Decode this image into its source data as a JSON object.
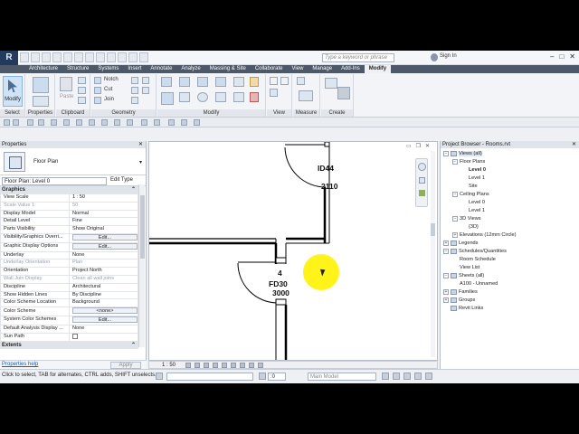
{
  "app": {
    "logo": "R",
    "search_placeholder": "Type a keyword or phrase",
    "sign_in": "Sign In"
  },
  "ribbon_tabs": [
    "Architecture",
    "Structure",
    "Systems",
    "Insert",
    "Annotate",
    "Analyze",
    "Massing & Site",
    "Collaborate",
    "View",
    "Manage",
    "Add-Ins",
    "Modify"
  ],
  "ribbon": {
    "modify_label": "Modify",
    "groups": [
      "Select",
      "Properties",
      "Clipboard",
      "Geometry",
      "Modify",
      "View",
      "Measure",
      "Create"
    ],
    "clipboard_paste": "Paste",
    "geometry_items": [
      "Notch",
      "Cut",
      "Join"
    ]
  },
  "properties": {
    "title": "Properties",
    "type_name": "Floor Plan",
    "instance": "Floor Plan: Level 0",
    "edit_type": "Edit Type",
    "section_graphics": "Graphics",
    "section_extents": "Extents",
    "rows": [
      {
        "k": "View Scale",
        "v": "1 : 50"
      },
      {
        "k": "Scale Value    1:",
        "v": "50"
      },
      {
        "k": "Display Model",
        "v": "Normal"
      },
      {
        "k": "Detail Level",
        "v": "Fine"
      },
      {
        "k": "Parts Visibility",
        "v": "Show Original"
      },
      {
        "k": "Visibility/Graphics Overri...",
        "v": "Edit..."
      },
      {
        "k": "Graphic Display Options",
        "v": "Edit..."
      },
      {
        "k": "Underlay",
        "v": "None"
      },
      {
        "k": "Underlay Orientation",
        "v": "Plan"
      },
      {
        "k": "Orientation",
        "v": "Project North"
      },
      {
        "k": "Wall Join Display",
        "v": "Clean all wall joins"
      },
      {
        "k": "Discipline",
        "v": "Architectural"
      },
      {
        "k": "Show Hidden Lines",
        "v": "By Discipline"
      },
      {
        "k": "Color Scheme Location",
        "v": "Background"
      },
      {
        "k": "Color Scheme",
        "v": "<none>"
      },
      {
        "k": "System Color Schemes",
        "v": "Edit..."
      },
      {
        "k": "Default Analysis Display ...",
        "v": "None"
      },
      {
        "k": "Sun Path",
        "v": ""
      }
    ],
    "help": "Properties help",
    "apply": "Apply"
  },
  "view": {
    "scale": "1 : 50",
    "tags": {
      "id44": "ID44",
      "d2110": "2110",
      "n4": "4",
      "fd30": "FD30",
      "d3000": "3000"
    }
  },
  "browser": {
    "title": "Project Browser - Rooms.rvt",
    "tree": [
      {
        "label": "Views (all)",
        "depth": 0,
        "tw": "−",
        "sel": true
      },
      {
        "label": "Floor Plans",
        "depth": 1,
        "tw": "−"
      },
      {
        "label": "Level 0",
        "depth": 2,
        "bold": true
      },
      {
        "label": "Level 1",
        "depth": 2
      },
      {
        "label": "Site",
        "depth": 2
      },
      {
        "label": "Ceiling Plans",
        "depth": 1,
        "tw": "−"
      },
      {
        "label": "Level 0",
        "depth": 2
      },
      {
        "label": "Level 1",
        "depth": 2
      },
      {
        "label": "3D Views",
        "depth": 1,
        "tw": "−"
      },
      {
        "label": "{3D}",
        "depth": 2
      },
      {
        "label": "Elevations (12mm Circle)",
        "depth": 1,
        "tw": "+"
      },
      {
        "label": "Legends",
        "depth": 0,
        "tw": "+",
        "icon": true
      },
      {
        "label": "Schedules/Quantities",
        "depth": 0,
        "tw": "−",
        "icon": true
      },
      {
        "label": "Room Schedule",
        "depth": 1
      },
      {
        "label": "View List",
        "depth": 1
      },
      {
        "label": "Sheets (all)",
        "depth": 0,
        "tw": "−",
        "icon": true
      },
      {
        "label": "A100 - Unnamed",
        "depth": 1
      },
      {
        "label": "Families",
        "depth": 0,
        "tw": "+",
        "icon": true
      },
      {
        "label": "Groups",
        "depth": 0,
        "tw": "+",
        "icon": true
      },
      {
        "label": "Revit Links",
        "depth": 0,
        "icon": true
      }
    ]
  },
  "status": {
    "message": "Click to select, TAB for alternates, CTRL adds, SHIFT unselects.",
    "model": "Main Model",
    "filter": ":0"
  }
}
